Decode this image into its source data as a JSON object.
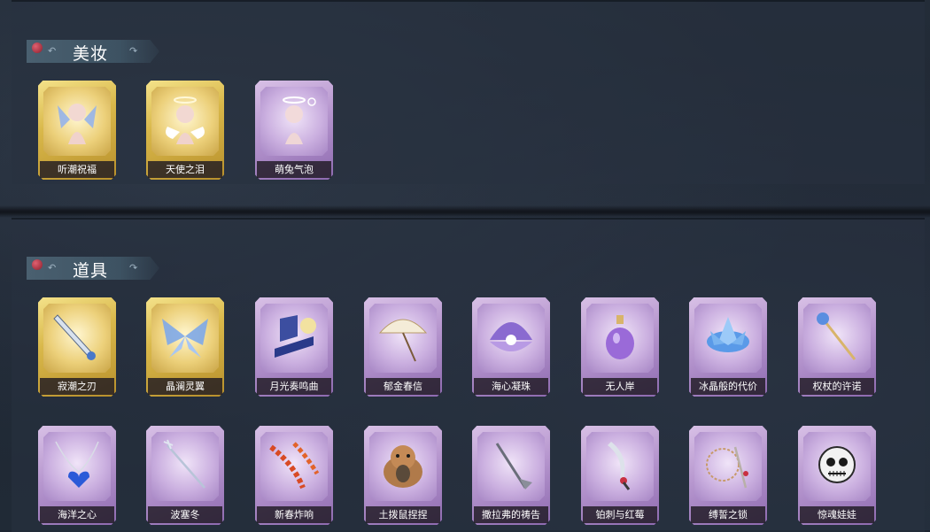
{
  "sections": [
    {
      "title": "美妆",
      "items": [
        {
          "label": "听潮祝福",
          "rarity": "gold",
          "icon": "figure-wings-blue-icon"
        },
        {
          "label": "天使之泪",
          "rarity": "gold",
          "icon": "figure-angel-halo-icon"
        },
        {
          "label": "萌兔气泡",
          "rarity": "purple",
          "icon": "figure-halo-bubble-icon"
        }
      ]
    },
    {
      "title": "道具",
      "items": [
        {
          "label": "寂潮之刃",
          "rarity": "gold",
          "icon": "blade-icon"
        },
        {
          "label": "晶澜灵翼",
          "rarity": "gold",
          "icon": "crystal-wings-icon"
        },
        {
          "label": "月光奏鸣曲",
          "rarity": "purple",
          "icon": "piano-icon"
        },
        {
          "label": "郁金春信",
          "rarity": "purple",
          "icon": "parasol-icon"
        },
        {
          "label": "海心凝珠",
          "rarity": "purple",
          "icon": "shell-pearl-icon"
        },
        {
          "label": "无人岸",
          "rarity": "purple",
          "icon": "perfume-bottle-icon"
        },
        {
          "label": "冰晶般的代价",
          "rarity": "purple",
          "icon": "lotus-icon"
        },
        {
          "label": "权杖的许诺",
          "rarity": "purple",
          "icon": "scepter-icon"
        },
        {
          "label": "海洋之心",
          "rarity": "purple",
          "icon": "heart-necklace-icon"
        },
        {
          "label": "波塞冬",
          "rarity": "purple",
          "icon": "trident-icon"
        },
        {
          "label": "新春炸响",
          "rarity": "purple",
          "icon": "firecracker-icon"
        },
        {
          "label": "土拨鼠捏捏",
          "rarity": "purple",
          "icon": "marmot-plush-icon"
        },
        {
          "label": "撒拉弗的祷告",
          "rarity": "purple",
          "icon": "ornate-staff-icon"
        },
        {
          "label": "铂刺与红莓",
          "rarity": "purple",
          "icon": "thorn-dagger-icon"
        },
        {
          "label": "缚誓之锁",
          "rarity": "purple",
          "icon": "chain-lock-icon"
        },
        {
          "label": "惊魂娃娃",
          "rarity": "purple",
          "icon": "skull-doll-icon"
        }
      ]
    }
  ],
  "colors": {
    "gold_frame": "#d9b84a",
    "purple_frame": "#b797cf",
    "background": "#1c2430",
    "header_bar": "#4a6070",
    "pin": "#c23a4a"
  }
}
